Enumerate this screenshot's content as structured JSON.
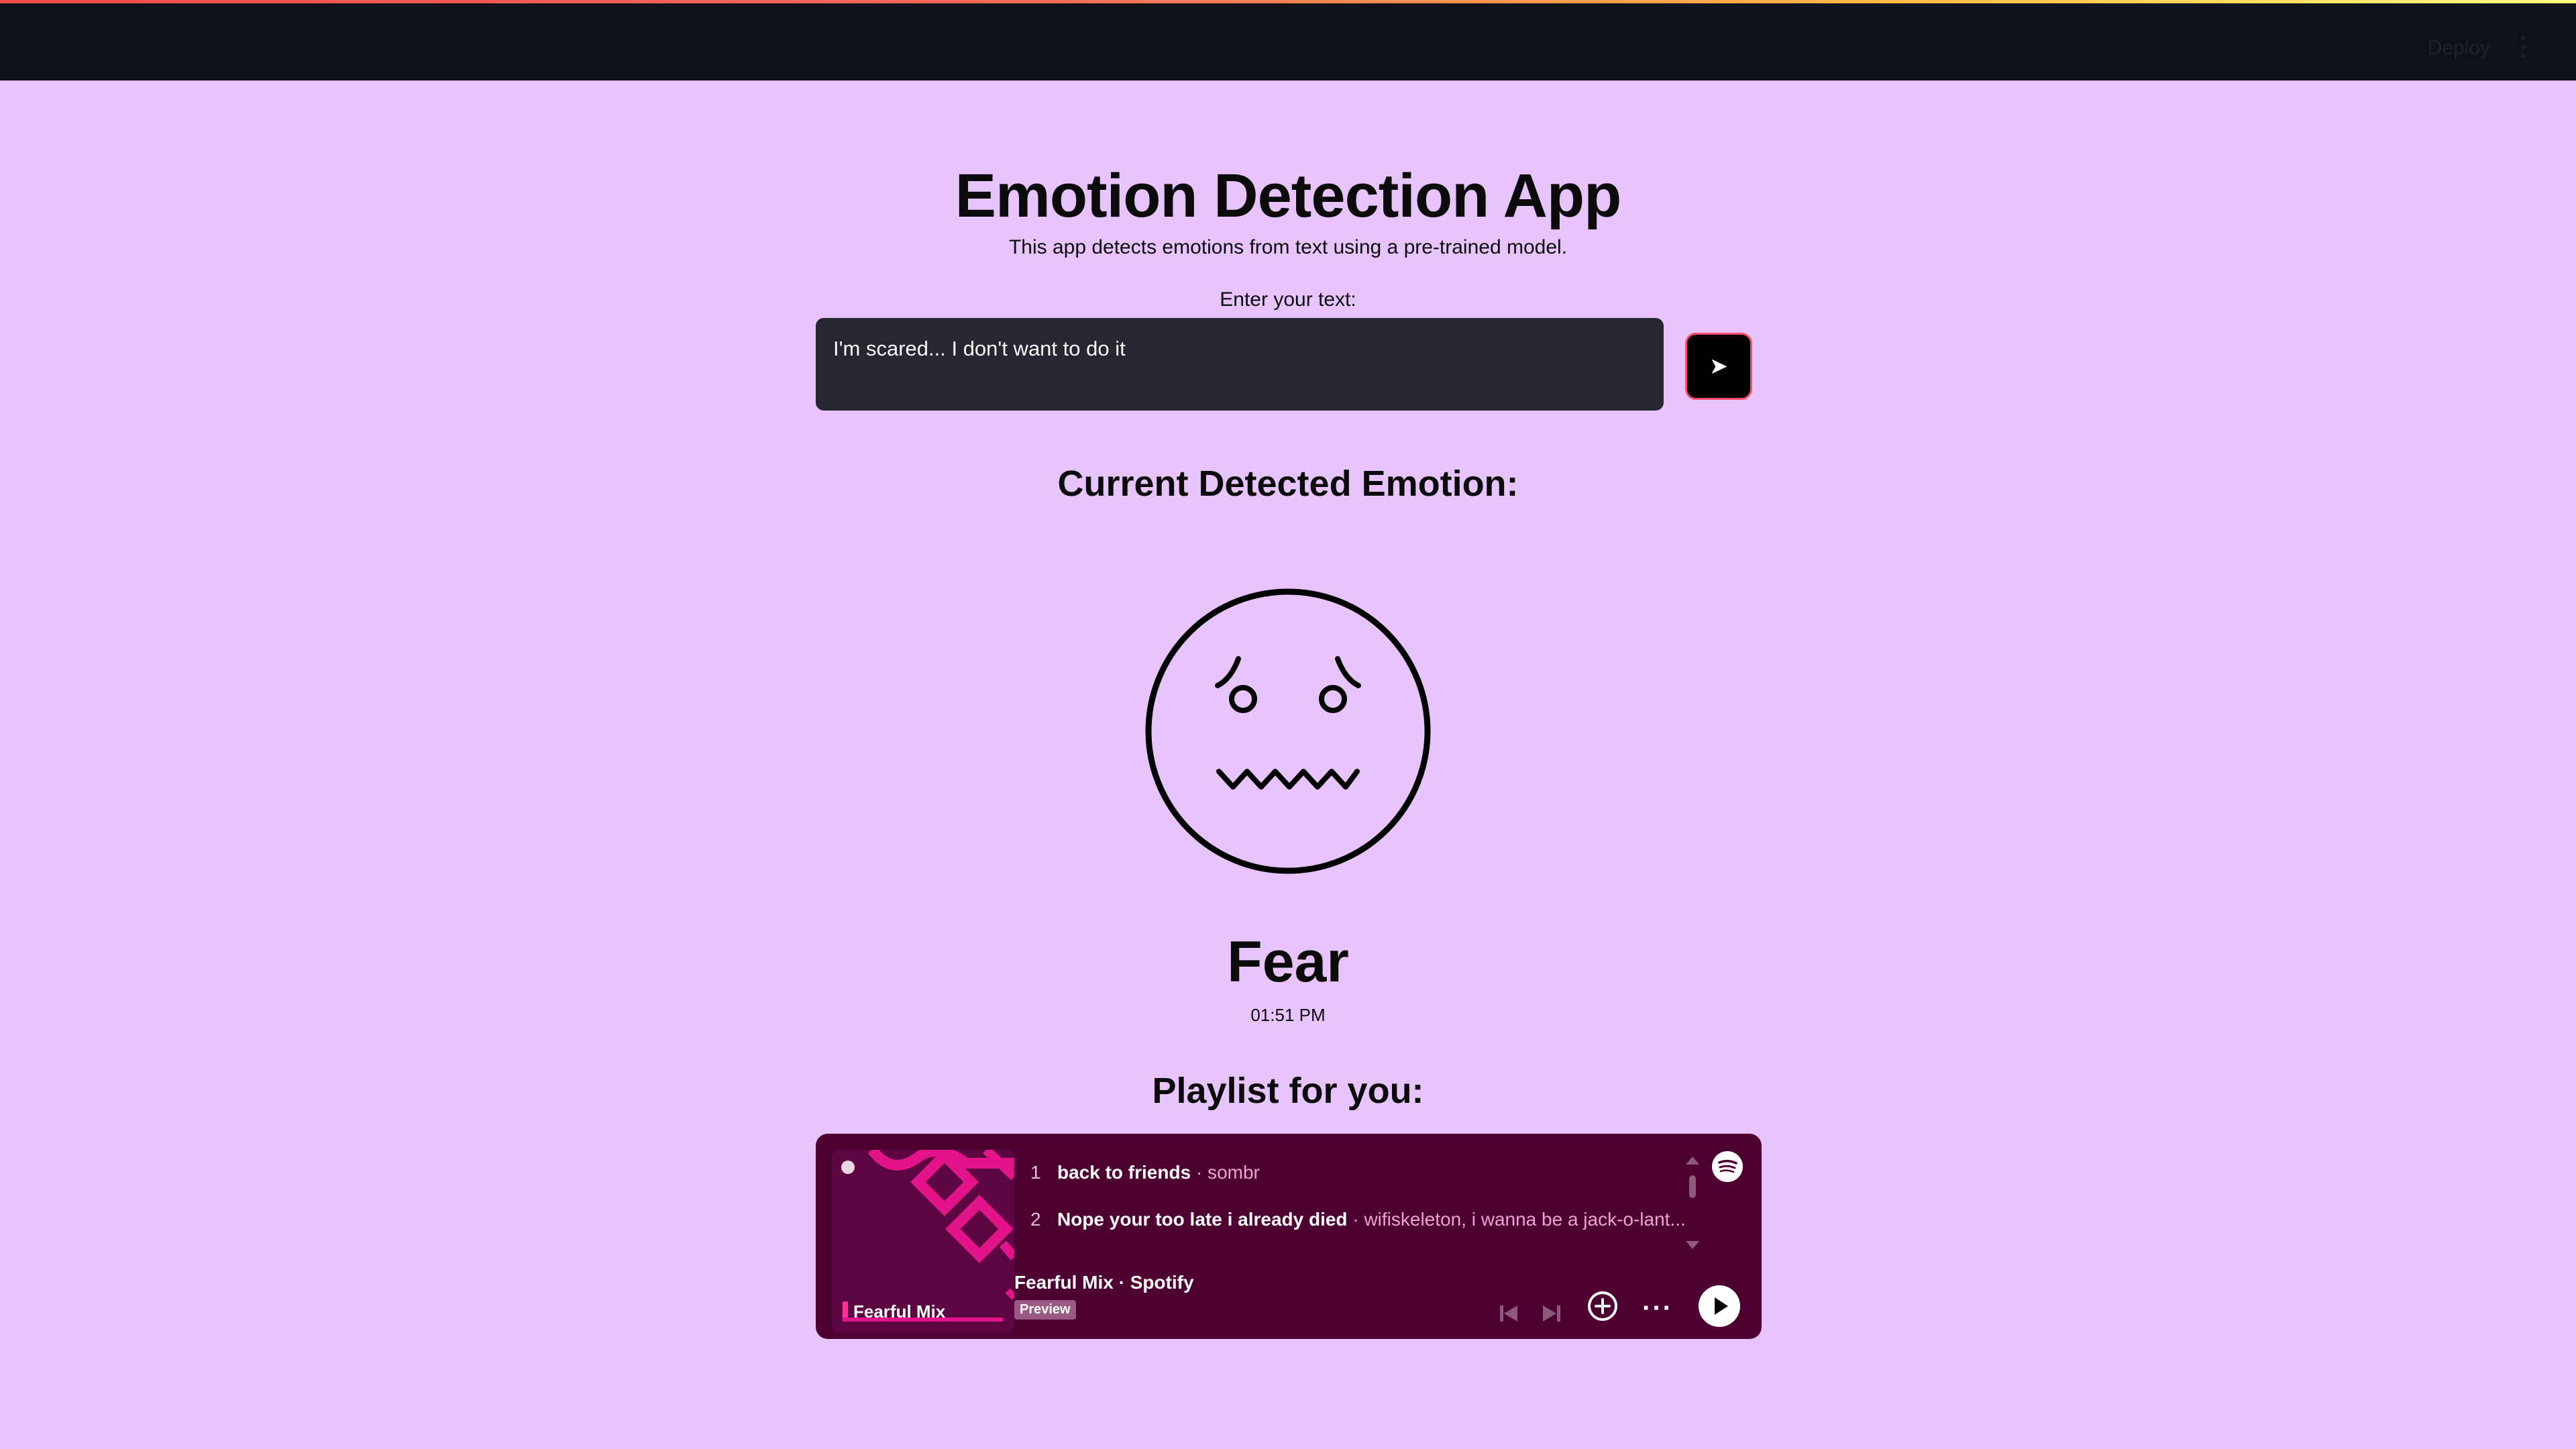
{
  "header": {
    "deploy_label": "Deploy",
    "menu_icon": "kebab-menu-icon"
  },
  "app": {
    "title": "Emotion Detection App",
    "subtitle": "This app detects emotions from text using a pre-trained model."
  },
  "input": {
    "label": "Enter your text:",
    "value": "I'm scared... I don't want to do it",
    "send_icon": "send-arrow-icon",
    "send_glyph": "➤"
  },
  "result": {
    "heading": "Current Detected Emotion:",
    "emotion": "Fear",
    "time": "01:51 PM",
    "face_icon": "fearful-face-icon"
  },
  "playlist": {
    "heading": "Playlist for you:",
    "cover_title": "Fearful Mix",
    "tracks": [
      {
        "num": "1",
        "name": "back to friends",
        "artist": "sombr"
      },
      {
        "num": "2",
        "name": "Nope your too late i already died",
        "artist": "wifiskeleton, i wanna be a jack-o-lant..."
      }
    ],
    "name": "Fearful Mix · Spotify",
    "preview_badge": "Preview",
    "more_glyph": "···"
  },
  "colors": {
    "background": "#e8c4fd",
    "header": "#0e1117",
    "input_bg": "#262730",
    "send_border": "#ff4b6b",
    "embed_bg": "#4e0032",
    "accent_pink": "#e3148a"
  }
}
